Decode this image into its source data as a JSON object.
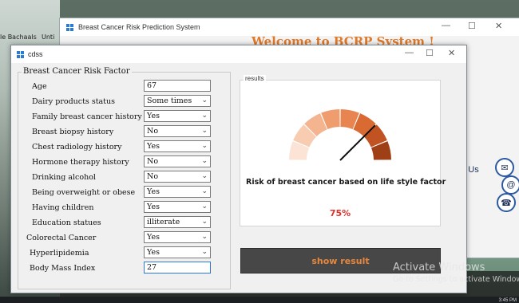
{
  "desktop": {
    "left_labels": [
      "le Bachaals",
      "Unti"
    ],
    "taskbar_time": "3:45 PM"
  },
  "main_window": {
    "title": "Breast Cancer Risk Prediction System",
    "welcome": "Welcome to BCRP System !",
    "contact_label": "Us"
  },
  "cdss": {
    "title": "cdss",
    "group_title": "Breast Cancer Risk Factor",
    "fields": [
      {
        "label": "Age",
        "value": "67",
        "type": "text"
      },
      {
        "label": "Dairy products status",
        "value": "Some times",
        "type": "select"
      },
      {
        "label": "Family breast cancer history",
        "value": "Yes",
        "type": "select"
      },
      {
        "label": "Breast biopsy history",
        "value": "No",
        "type": "select"
      },
      {
        "label": "Chest radiology history",
        "value": "Yes",
        "type": "select"
      },
      {
        "label": "Hormone therapy history",
        "value": "No",
        "type": "select"
      },
      {
        "label": "Drinking alcohol",
        "value": "No",
        "type": "select"
      },
      {
        "label": "Being overweight or obese",
        "value": "Yes",
        "type": "select"
      },
      {
        "label": "Having children",
        "value": "Yes",
        "type": "select"
      },
      {
        "label": "Education statues",
        "value": "illiterate",
        "type": "select"
      },
      {
        "label": "Colorectal Cancer",
        "value": "Yes",
        "type": "select"
      },
      {
        "label": "Hyperlipidemia",
        "value": "Yes",
        "type": "select"
      },
      {
        "label": "Body Mass Index",
        "value": "27",
        "type": "text"
      }
    ],
    "results": {
      "legend": "results",
      "caption": "Risk of breast cancer based on life style factor",
      "percent_text": "75%",
      "risk_fraction": 0.75,
      "gauge_colors": [
        "#fbe4d6",
        "#f7ccb1",
        "#f3b48f",
        "#ef9d6e",
        "#e8844f",
        "#d86a32",
        "#c05321",
        "#9e3f16"
      ]
    },
    "show_button": "show result"
  },
  "watermark": {
    "line1": "Activate Windows",
    "line2": "Go to Settings to activate Windows."
  }
}
